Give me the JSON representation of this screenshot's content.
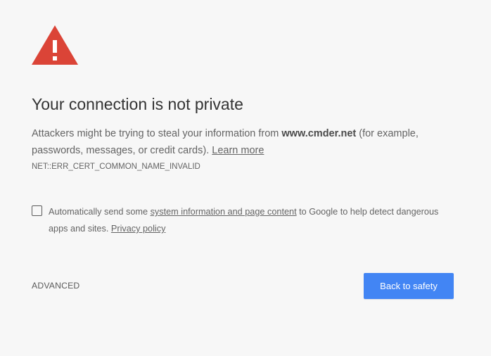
{
  "icon": {
    "name": "warning-triangle-icon",
    "color": "#db4437",
    "mark": "!"
  },
  "title": "Your connection is not private",
  "explanation": {
    "before_host": "Attackers might be trying to steal your information from ",
    "host": "www.cmder.net",
    "after_host": " (for example, passwords, messages, or credit cards). ",
    "learn_more": "Learn more"
  },
  "error_code": "NET::ERR_CERT_COMMON_NAME_INVALID",
  "optin": {
    "checked": false,
    "before_link": "Automatically send some ",
    "system_info_link": "system information and page content",
    "after_link": " to Google to help detect dangerous apps and sites. ",
    "privacy_link": "Privacy policy"
  },
  "buttons": {
    "advanced": "ADVANCED",
    "back_to_safety": "Back to safety",
    "primary_color": "#4285f4"
  }
}
